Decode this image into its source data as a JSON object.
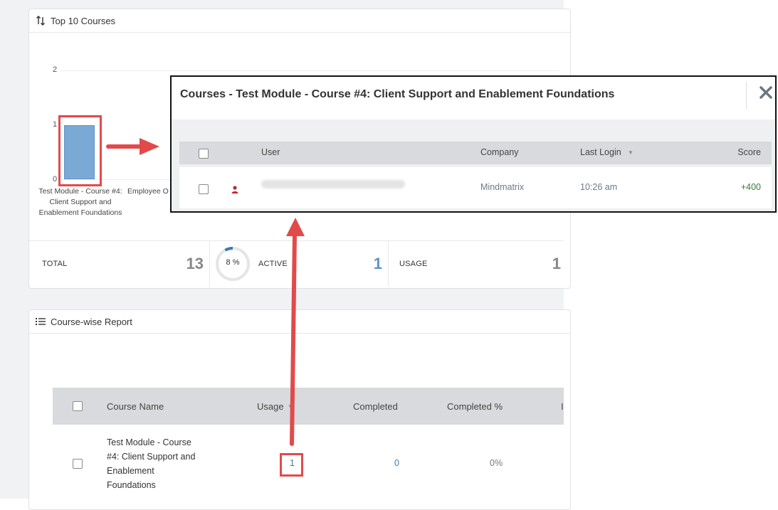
{
  "top_courses": {
    "title": "Top 10 Courses",
    "y_ticks": [
      "2",
      "1",
      "0"
    ],
    "bar_label_1": "Test Module - Course #4: Client Support and Enablement Foundations",
    "bar_label_2": "Employee O",
    "stats": {
      "total_label": "TOTAL",
      "total_value": "13",
      "percent": "8 %",
      "percent_fraction": 0.08,
      "active_label": "ACTIVE",
      "active_value": "1",
      "usage_label": "USAGE",
      "usage_value": "1"
    }
  },
  "chart_data": {
    "type": "bar",
    "categories": [
      "Test Module - Course #4: Client Support and Enablement Foundations",
      "Employee O"
    ],
    "values": [
      1,
      0
    ],
    "ylim": [
      0,
      2
    ]
  },
  "course_report": {
    "title": "Course-wise Report",
    "columns": [
      "Course Name",
      "Usage",
      "Completed",
      "Completed %",
      "I"
    ],
    "rows": [
      {
        "course_name": "Test Module - Course #4: Client Support and Enablement Foundations",
        "usage": "1",
        "completed": "0",
        "completed_pct": "0%"
      }
    ]
  },
  "modal": {
    "title": "Courses - Test Module - Course #4: Client Support and Enablement Foundations",
    "columns": {
      "user": "User",
      "company": "Company",
      "last_login": "Last Login",
      "score": "Score"
    },
    "rows": [
      {
        "user": "",
        "company": "Mindmatrix",
        "last_login": "10:26 am",
        "score": "+400"
      }
    ]
  },
  "colors": {
    "accent": "#3a78b8",
    "bar": "#7aa9d6",
    "highlight": "#e24a4a",
    "score": "#3c7a3c"
  }
}
